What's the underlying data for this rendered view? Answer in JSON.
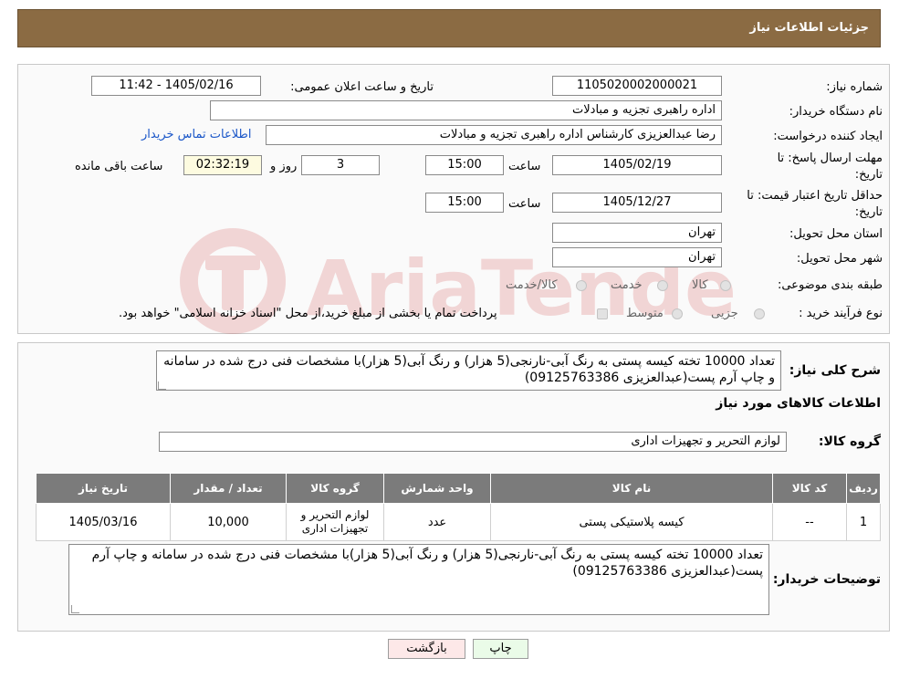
{
  "header": {
    "title": "جزئیات اطلاعات نیاز"
  },
  "form": {
    "need_number_label": "شماره نیاز:",
    "need_number": "1105020002000021",
    "announce_label": "تاریخ و ساعت اعلان عمومی:",
    "announce_value": "1405/02/16 - 11:42",
    "buyer_org_label": "نام دستگاه خریدار:",
    "buyer_org": "اداره راهبری تجزیه و مبادلات",
    "requester_label": "ایجاد کننده درخواست:",
    "requester": "رضا عبدالعزیزی کارشناس اداره راهبری تجزیه و مبادلات",
    "contact_link": "اطلاعات تماس خریدار",
    "deadline_label_1": "مهلت ارسال پاسخ: تا",
    "deadline_label_2": "تاریخ:",
    "deadline_date": "1405/02/19",
    "time_label": "ساعت",
    "deadline_time": "15:00",
    "days_value": "3",
    "days_label": "روز و",
    "remaining_time": "02:32:19",
    "remaining_label": "ساعت باقی مانده",
    "validity_label_1": "حداقل تاریخ اعتبار قیمت: تا",
    "validity_label_2": "تاریخ:",
    "validity_date": "1405/12/27",
    "validity_time": "15:00",
    "province_label": "استان محل تحویل:",
    "province": "تهران",
    "city_label": "شهر محل تحویل:",
    "city": "تهران",
    "category_label": "طبقه بندی موضوعی:",
    "category_options": [
      "کالا",
      "خدمت",
      "کالا/خدمت"
    ],
    "process_label": "نوع فرآیند خرید :",
    "process_options": [
      "جزیی",
      "متوسط"
    ],
    "process_note": "پرداخت تمام یا بخشی از مبلغ خرید،از محل \"اسناد خزانه اسلامی\" خواهد بود."
  },
  "watermark": {
    "text": "AriaTender.neT"
  },
  "description": {
    "label": "شرح کلی نیاز:",
    "text": "تعداد 10000 تخته کیسه پستی به رنگ آبی-نارنجی(5 هزار) و رنگ آبی(5 هزار)با مشخصات فنی درج شده در سامانه و چاپ آرم پست(عبدالعزیزی 09125763386)"
  },
  "goods_section": {
    "title": "اطلاعات کالاهای مورد نیاز",
    "group_label": "گروه کالا:",
    "group_value": "لوازم التحریر و تجهیزات اداری"
  },
  "table": {
    "headers": [
      "ردیف",
      "کد کالا",
      "نام کالا",
      "واحد شمارش",
      "گروه کالا",
      "تعداد / مقدار",
      "تاریخ نیاز"
    ],
    "rows": [
      [
        "1",
        "--",
        "کیسه پلاستیکی پستی",
        "عدد",
        "لوازم التحریر و تجهیزات اداری",
        "10,000",
        "1405/03/16"
      ]
    ]
  },
  "buyer_notes": {
    "label": "توضیحات خریدار:",
    "text": "تعداد 10000 تخته کیسه پستی به رنگ آبی-نارنجی(5 هزار) و رنگ آبی(5 هزار)با مشخصات فنی درج شده در سامانه و چاپ آرم پست(عبدالعزیزی 09125763386)"
  },
  "buttons": {
    "print": "چاپ",
    "back": "بازگشت"
  },
  "colors": {
    "header": "#8b6b43",
    "table_header": "#7b7b7b",
    "link": "#1a56c8"
  }
}
